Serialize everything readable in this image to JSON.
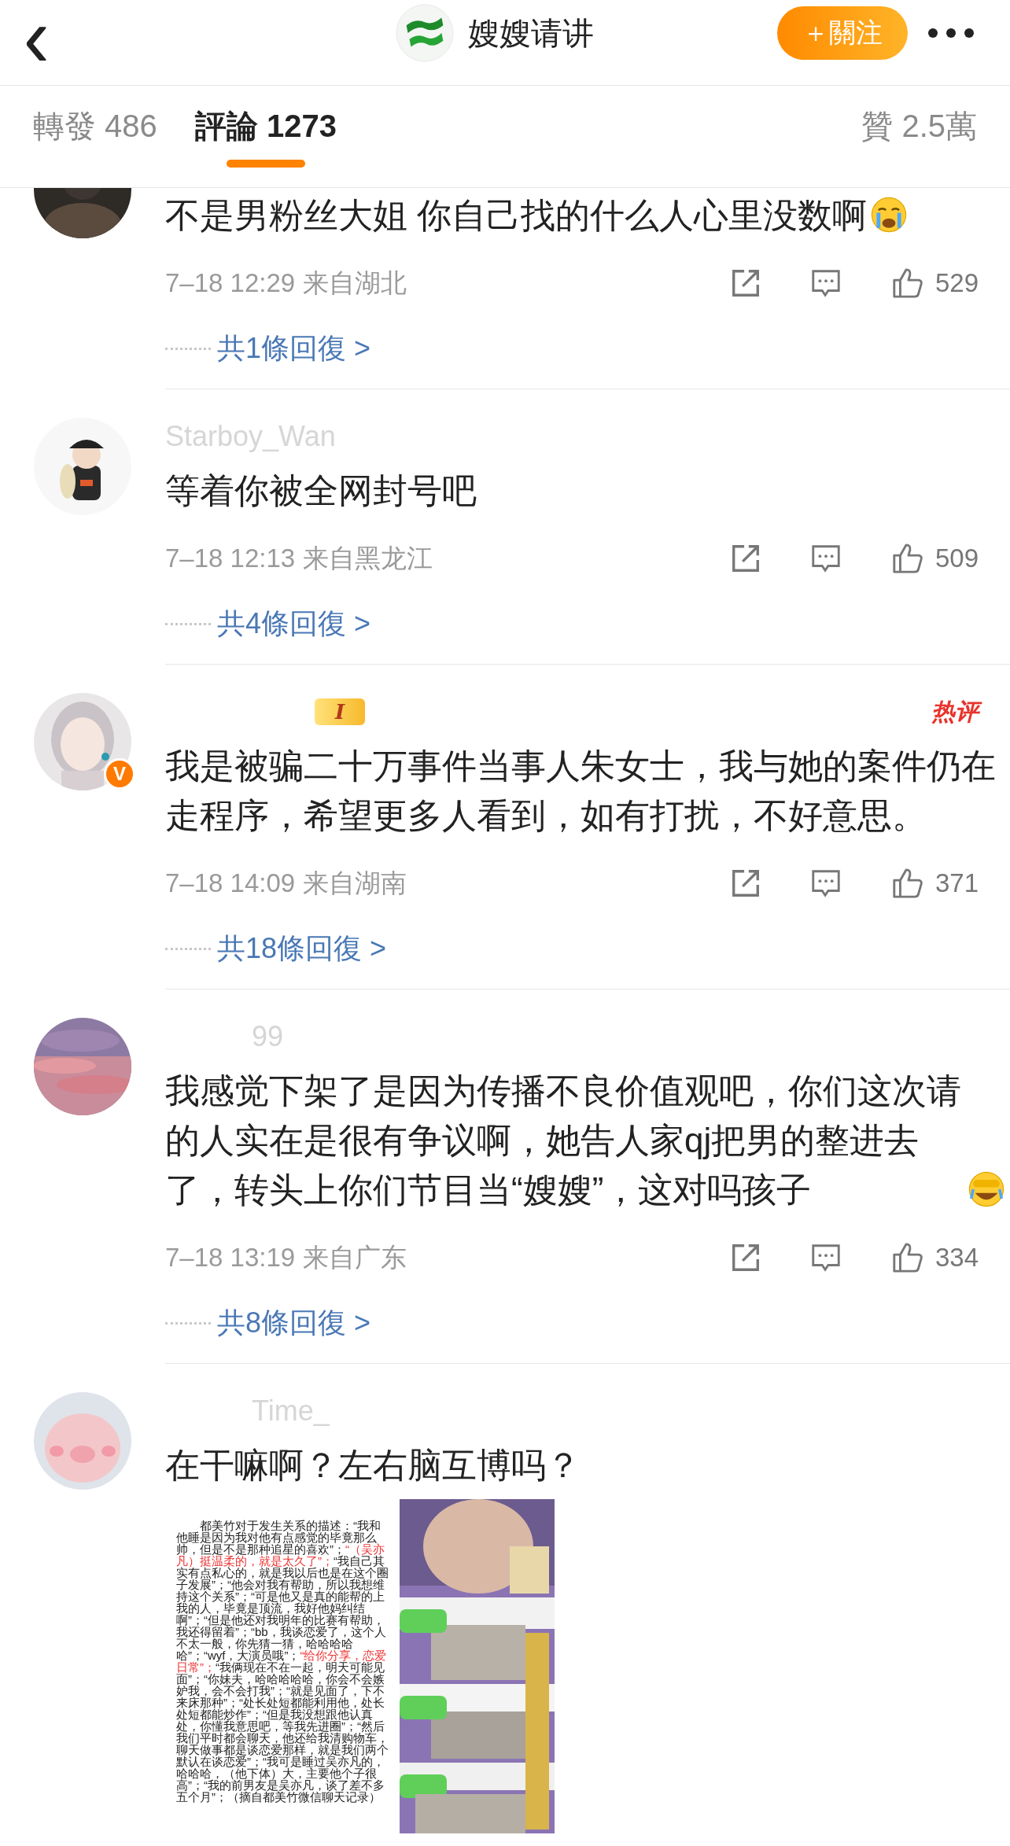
{
  "header": {
    "back": "‹",
    "title": "嫂嫂请讲",
    "follow_button": "＋關注"
  },
  "tabs": [
    {
      "label": "轉發 486",
      "selected": false
    },
    {
      "label": "評論 1273",
      "selected": true
    },
    {
      "label": "贊 2.5萬",
      "selected": false
    }
  ],
  "comments": [
    {
      "text": "不是男粉丝大姐 你自己找的什么人心里没数啊",
      "emoji": {
        "kind": "crying"
      },
      "time": "7–18 12:29",
      "location": "来自湖北",
      "likes": "529",
      "replies": "共1條回復 >"
    },
    {
      "name": "Starboy_Wan",
      "text": "等着你被全网封号吧",
      "time": "7–18 12:13",
      "location": "来自黑龙江",
      "likes": "509",
      "replies": "共4條回復 >"
    },
    {
      "level_badge": "I",
      "hot_tag": "热评",
      "verified_badge": "V",
      "text": "我是被骗二十万事件当事人朱女士，我与她的案件仍在走程序，希望更多人看到，如有打扰，不好意思。",
      "time": "7–18 14:09",
      "location": "来自湖南",
      "likes": "371",
      "replies": "共18條回復 >"
    },
    {
      "name": "99",
      "text": "我感觉下架了是因为传播不良价值观吧，你们这次请的人实在是很有争议啊，她告人家qj把男的整进去了，转头上你们节目当“嫂嫂”，这对吗孩子",
      "emoji": {
        "kind": "laughing"
      },
      "time": "7–18 13:19",
      "location": "来自广东",
      "likes": "334",
      "replies": "共8條回復 >"
    },
    {
      "name": "Time_",
      "text": "在干嘛啊？左右脑互博吗？",
      "attachment": [
        {
          "text": "都美竹对于发生关系的描述：“我和他睡是因为我对他有点感觉的毕竟那么帅，但是不是那种追星的喜欢”；",
          "highlight": false
        },
        {
          "text": "“（吴亦凡）挺温柔的，就是太久了”；",
          "highlight": true
        },
        {
          "text": "“我自己其实有点私心的，就是我以后也是在这个圈子发展”；“他会对我有帮助，所以我想维持这个关系”；“可是他又是真的能帮的上我的人，毕竟是顶流，我好他妈纠结啊”；“但是他还对我明年的比赛有帮助，我还得留着”；“bb，我谈恋爱了，这个人不太一般，你先猜一猜，哈哈哈哈哈”；“wyf，大演员哦”；",
          "highlight": false
        },
        {
          "text": "“给你分享，恋爱日常”；",
          "highlight": true
        },
        {
          "text": "“我俩现在不在一起，明天可能见面”；“你妹夫，哈哈哈哈哈，你会不会嫉妒我，会不会打我”；“就是见面了，下不来床那种”；“处长处短都能利用他，处长处短都能炒作”；“但是我没想跟他认真处，你懂我意思吧，等我先进圈”；“然后我们平时都会聊天，他还给我清购物车，聊天做事都是谈恋爱那样，就是我们两个默认在谈恋爱”；“我可是睡过吴亦凡的，哈哈哈，（他下体）大，主要他个子很高”；“我的前男友是吴亦凡，谈了差不多五个月”；（摘自都美竹微信聊天记录）",
          "highlight": false
        }
      ]
    }
  ]
}
